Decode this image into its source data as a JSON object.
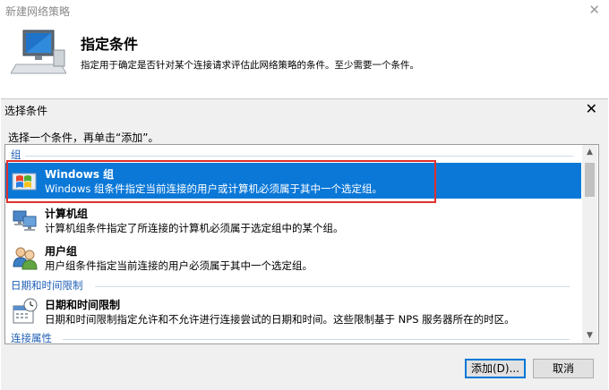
{
  "wizard": {
    "title": "新建网络策略",
    "heading": "指定条件",
    "description": "指定用于确定是否针对某个连接请求评估此网络策略的条件。至少需要一个条件。",
    "close_glyph": "✕"
  },
  "dialog": {
    "title": "选择条件",
    "close_glyph": "✕",
    "instruction": "选择一个条件，再单击“添加”。",
    "groups": [
      {
        "header": "组"
      },
      {
        "header": "日期和时间限制"
      },
      {
        "header": "连接属性"
      }
    ],
    "items": [
      {
        "name": "Windows 组",
        "description": "Windows 组条件指定当前连接的用户或计算机必须属于其中一个选定组。",
        "icon": "windows-flag-icon",
        "selected": true
      },
      {
        "name": "计算机组",
        "description": "计算机组条件指定了所连接的计算机必须属于选定组中的某个组。",
        "icon": "computer-group-icon",
        "selected": false
      },
      {
        "name": "用户组",
        "description": "用户组条件指定当前连接的用户必须属于其中一个选定组。",
        "icon": "user-group-icon",
        "selected": false
      },
      {
        "name": "日期和时间限制",
        "description": "日期和时间限制指定允许和不允许进行连接尝试的日期和时间。这些限制基于 NPS 服务器所在的时区。",
        "icon": "calendar-clock-icon",
        "selected": false
      }
    ],
    "scroll": {
      "up_glyph": "▲",
      "down_glyph": "▼"
    },
    "buttons": {
      "add": "添加(D)...",
      "cancel": "取消"
    }
  },
  "colors": {
    "selection": "#0b78d7",
    "group_header": "#1f5fb7",
    "highlight_box": "#e0302d"
  }
}
